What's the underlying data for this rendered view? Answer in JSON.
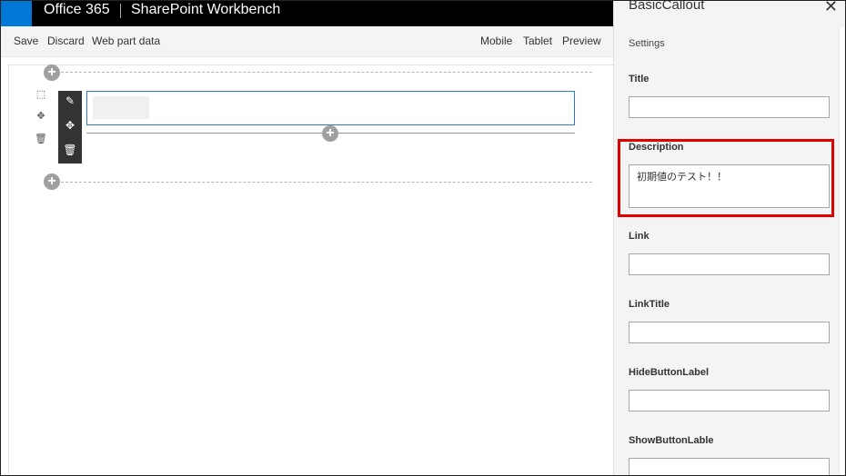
{
  "suite": {
    "brand": "Office 365",
    "app": "SharePoint Workbench"
  },
  "commands": {
    "save": "Save",
    "discard": "Discard",
    "web_part_data": "Web part data",
    "mobile": "Mobile",
    "tablet": "Tablet",
    "preview": "Preview"
  },
  "icons": {
    "add": "+",
    "edit": "✎",
    "move": "✥",
    "delete": "🗑",
    "section_settings": "⬚",
    "close": "✕"
  },
  "pane": {
    "title": "BasicCallout",
    "subtitle": "Settings",
    "fields": {
      "title": {
        "label": "Title",
        "value": ""
      },
      "description": {
        "label": "Description",
        "value": "初期値のテスト！！"
      },
      "link": {
        "label": "Link",
        "value": ""
      },
      "link_title": {
        "label": "LinkTitle",
        "value": ""
      },
      "hide_button_label": {
        "label": "HideButtonLabel",
        "value": ""
      },
      "show_button_lable": {
        "label": "ShowButtonLable",
        "value": ""
      }
    }
  },
  "colors": {
    "suite_bar": "#000000",
    "waffle": "#0078d7",
    "accent_border": "#2b79d6",
    "highlight": "#e00000"
  }
}
